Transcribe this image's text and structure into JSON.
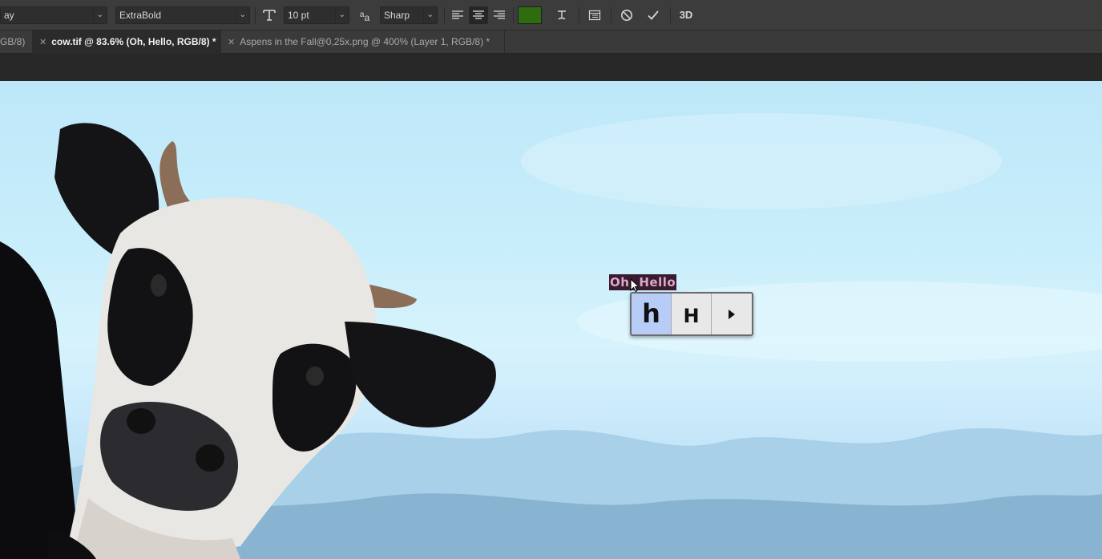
{
  "toolbar": {
    "font_family_value": "ay",
    "font_style_value": "ExtraBold",
    "font_size_value": "10 pt",
    "antialias_icon_label": "a",
    "antialias_icon_label2": "a",
    "antialias_value": "Sharp",
    "text_color": "#2f6b0f",
    "three_d_label": "3D",
    "icons": [
      "font-size-icon",
      "antialias-icon",
      "align-left-icon",
      "align-center-icon",
      "align-right-icon",
      "warp-text-icon",
      "panels-icon",
      "cancel-icon",
      "commit-icon"
    ]
  },
  "tabs": [
    {
      "label": "GB/8)"
    },
    {
      "label": "cow.tif @ 83.6% (Oh, Hello, RGB/8) *",
      "active": true
    },
    {
      "label": "Aspens in the Fall@0,25x.png @ 400% (Layer 1, RGB/8) *"
    }
  ],
  "canvas": {
    "text_layer": "Oh, Hello",
    "glyph_alternates": {
      "options": [
        "h",
        "H"
      ],
      "selected_index": 0,
      "more_icon": "triangle-right-icon"
    }
  },
  "colors": {
    "toolbar_bg": "#3c3c3c",
    "tab_active_bg": "#2b2b2b",
    "text_highlight": "#3a1a2e",
    "glyph_selected": "#b7cdf8"
  }
}
